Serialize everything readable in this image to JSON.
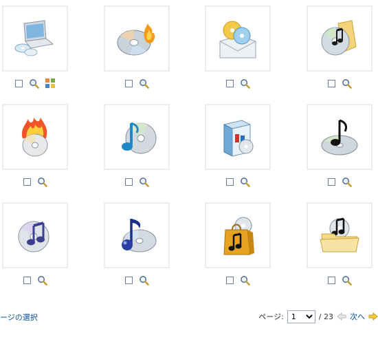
{
  "icons": [
    {
      "name": "laptop-cd-icon"
    },
    {
      "name": "cd-burn-icon"
    },
    {
      "name": "cd-mail-icon"
    },
    {
      "name": "music-folder-cd-icon"
    },
    {
      "name": "flame-cd-icon"
    },
    {
      "name": "cd-music-note-icon"
    },
    {
      "name": "software-box-icon"
    },
    {
      "name": "cd-music-note-dark-icon"
    },
    {
      "name": "cd-double-note-icon"
    },
    {
      "name": "cd-blue-note-icon"
    },
    {
      "name": "music-shopping-bag-icon"
    },
    {
      "name": "music-folder-icon"
    }
  ],
  "footer": {
    "select_page_link": "ージの選択",
    "page_label": "ページ:",
    "current_page": "1",
    "total_pages": "/ 23",
    "next_label": "次へ"
  },
  "colors": {
    "tile_border": "#ececec",
    "link": "#0a4fa0"
  }
}
